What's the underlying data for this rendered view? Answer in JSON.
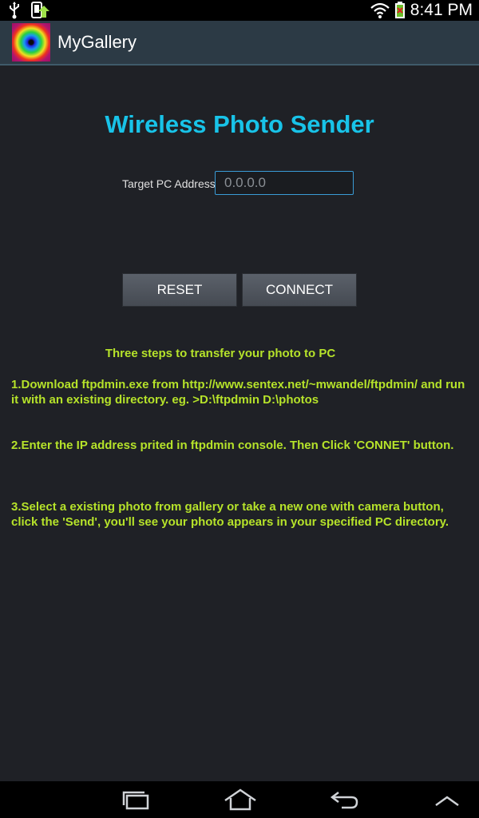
{
  "status_bar": {
    "time": "8:41 PM",
    "icons": [
      "usb-icon",
      "download-icon",
      "wifi-icon",
      "battery-charging-icon"
    ]
  },
  "action_bar": {
    "app_icon": "mygallery-app-icon",
    "title": "MyGallery"
  },
  "main": {
    "title": "Wireless Photo Sender",
    "address_label": "Target PC Address",
    "address_placeholder": "0.0.0.0",
    "address_value": "",
    "reset_label": "RESET",
    "connect_label": "CONNECT"
  },
  "instructions": {
    "title": "Three steps to transfer your photo to PC",
    "step1": "1.Download ftpdmin.exe from http://www.sentex.net/~mwandel/ftpdmin/ and run it with an existing directory. eg. >D:\\ftpdmin D:\\photos",
    "step2": "2.Enter the IP address prited in ftpdmin console. Then Click 'CONNET' button.",
    "step3": "3.Select a existing photo from gallery or take a new one with camera button, click the 'Send', you'll see your photo appears in your specified PC directory."
  },
  "nav_bar": {
    "icons": [
      "recent-apps-icon",
      "home-icon",
      "back-icon",
      "menu-up-icon"
    ]
  },
  "colors": {
    "background": "#1f2126",
    "title": "#18c3e8",
    "instructions": "#b6e32a",
    "action_bar": "#2c3a45"
  }
}
